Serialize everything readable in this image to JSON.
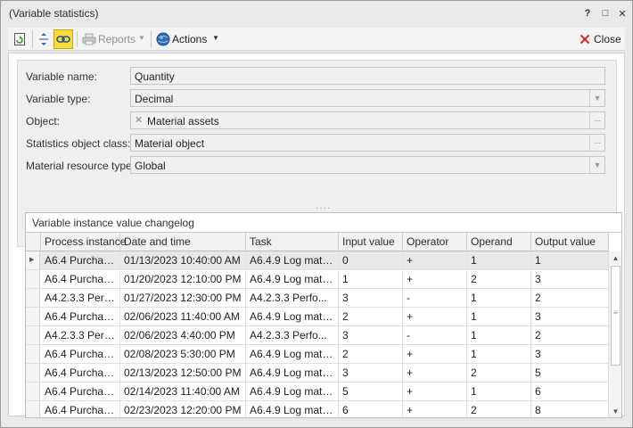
{
  "window": {
    "title": "(Variable statistics)",
    "help": "?",
    "restore": "□",
    "close": "✕"
  },
  "toolbar": {
    "reports": "Reports",
    "actions": "Actions",
    "close": "Close"
  },
  "form": {
    "variable_name": {
      "label": "Variable name:",
      "value": "Quantity"
    },
    "variable_type": {
      "label": "Variable type:",
      "value": "Decimal"
    },
    "object": {
      "label": "Object:",
      "value": "Material assets"
    },
    "statistics_class": {
      "label": "Statistics object class:",
      "value": "Material object"
    },
    "resource_type": {
      "label": "Material resource type:",
      "value": "Global"
    }
  },
  "changelog": {
    "title": "Variable instance value changelog",
    "columns": [
      "Process instance",
      "Date and time",
      "Task",
      "Input value",
      "Operator",
      "Operand",
      "Output value"
    ],
    "rows": [
      [
        "A6.4 Purchase...",
        "01/13/2023 10:40:00 AM",
        "A6.4.9 Log mater...",
        "0",
        "+",
        "1",
        "1"
      ],
      [
        "A6.4 Purchase...",
        "01/20/2023 12:10:00 PM",
        "A6.4.9 Log mater...",
        "1",
        "+",
        "2",
        "3"
      ],
      [
        "A4.2.3.3 Perf...",
        "01/27/2023 12:30:00 PM",
        "A4.2.3.3 Perfo...",
        "3",
        "-",
        "1",
        "2"
      ],
      [
        "A6.4 Purchase...",
        "02/06/2023 11:40:00 AM",
        "A6.4.9 Log mater...",
        "2",
        "+",
        "1",
        "3"
      ],
      [
        "A4.2.3.3 Perf...",
        "02/06/2023 4:40:00 PM",
        "A4.2.3.3 Perfo...",
        "3",
        "-",
        "1",
        "2"
      ],
      [
        "A6.4 Purchase...",
        "02/08/2023 5:30:00 PM",
        "A6.4.9 Log mater...",
        "2",
        "+",
        "1",
        "3"
      ],
      [
        "A6.4 Purchase...",
        "02/13/2023 12:50:00 PM",
        "A6.4.9 Log mater...",
        "3",
        "+",
        "2",
        "5"
      ],
      [
        "A6.4 Purchase...",
        "02/14/2023 11:40:00 AM",
        "A6.4.9 Log mater...",
        "5",
        "+",
        "1",
        "6"
      ],
      [
        "A6.4 Purchase...",
        "02/23/2023 12:20:00 PM",
        "A6.4.9 Log mater...",
        "6",
        "+",
        "2",
        "8"
      ]
    ]
  },
  "icons": {
    "refresh": "refresh-icon",
    "expand": "expand-icon",
    "link": "link-icon",
    "print": "printer-icon",
    "actions": "globe-icon",
    "close": "close-x-icon"
  },
  "colors": {
    "active_toggle": "#f6dd3d",
    "close_x": "#d8282c",
    "actions_icon": "#2f6db5"
  }
}
